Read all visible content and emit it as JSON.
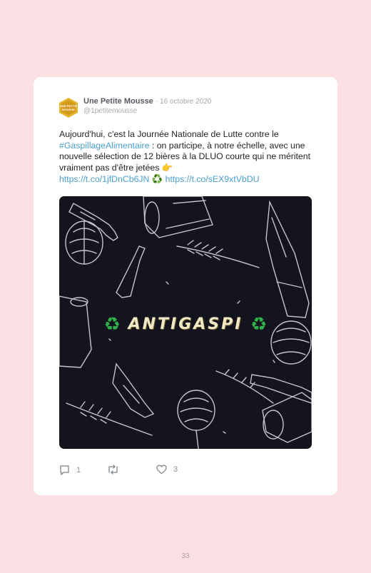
{
  "tweet": {
    "author_name": "Une Petite Mousse",
    "date": "16 octobre 2020",
    "handle": "@1petitemousse",
    "avatar_text": "UNE PETITE MOUSSE",
    "text_intro": "Aujourd'hui, c'est la Journée Nationale de Lutte contre le",
    "hashtag": "#GaspillageAlimentaire",
    "text_rest": " : on participe, à notre échelle, avec une nouvelle sélection de 12 bières à la DLUO courte qui ne méritent vraiment pas d'être jetées ",
    "pointing_emoji": "👉",
    "link_1": "https://t.co/1jfDnCb6JN",
    "recycle_emoji": "♻️",
    "link_2": "https://t.co/sEX9xtVbDU",
    "media_banner": "ANTIGASPI",
    "media_recycle_left": "♻",
    "media_recycle_right": "♻"
  },
  "actions": {
    "reply_count": "1",
    "retweet_count": "",
    "like_count": "3"
  },
  "page": {
    "number": "33"
  },
  "colors": {
    "background": "#fce1e4",
    "card": "#ffffff",
    "link": "#4a9fd0",
    "media_background": "#14141f",
    "avatar": "#e6b42c"
  }
}
